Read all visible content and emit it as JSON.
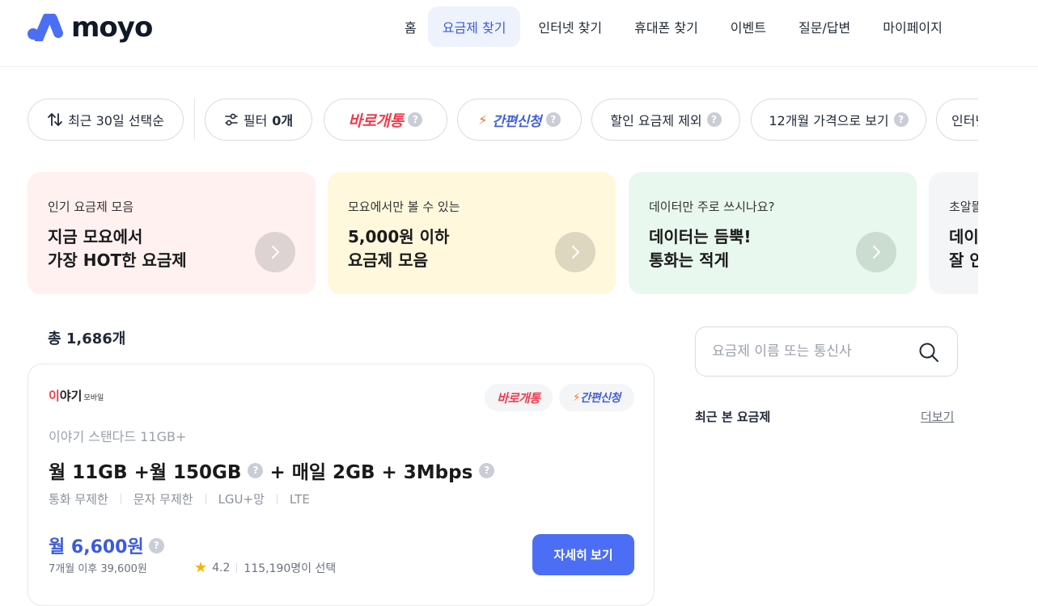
{
  "header": {
    "logo_text": "moyo",
    "nav": [
      "홈",
      "요금제 찾기",
      "인터넷 찾기",
      "휴대폰 찾기",
      "이벤트",
      "질문/답변",
      "마이페이지"
    ],
    "active_nav": "요금제 찾기"
  },
  "filters": {
    "sort_label": "최근 30일 선택순",
    "filter_label": "필터",
    "filter_count": "0개",
    "baro": "바로개통",
    "gan": "간편신청",
    "discount_exclude": "할인 요금제 제외",
    "twelve_month": "12개월 가격으로 보기",
    "internet_partial": "인터넷"
  },
  "banners": [
    {
      "sub": "인기 요금제 모음",
      "title": "지금 모요에서\n가장 HOT한 요금제",
      "bg": "#fff1f0",
      "arrow_bg": "#ddd3d2"
    },
    {
      "sub": "모요에서만 볼 수 있는",
      "title": "5,000원 이하\n요금제 모음",
      "bg": "#fff8dc",
      "arrow_bg": "#ddd7c0"
    },
    {
      "sub": "데이터만 주로 쓰시나요?",
      "title": "데이터는 듬뿍!\n통화는 적게",
      "bg": "#e9f8ee",
      "arrow_bg": "#cbdcd0"
    },
    {
      "sub": "초알뜰",
      "title": "데이\n잘 안",
      "bg": "#f4f5f7",
      "arrow_bg": "#d9dbe0"
    }
  ],
  "total": "총 1,686개",
  "plan": {
    "brand": "이야기",
    "brand_sub": "모바일",
    "tag_baro": "바로개통",
    "tag_gan": "간편신청",
    "name": "이야기 스탠다드 11GB+",
    "main_part1": "월 11GB +월 150GB",
    "main_part2": "+ 매일 2GB + 3Mbps",
    "specs": [
      "통화 무제한",
      "문자 무제한",
      "LGU+망",
      "LTE"
    ],
    "price": "월 6,600원",
    "after_price": "7개월 이후 39,600원",
    "rating": "4.2",
    "selected_count": "115,190명이 선택",
    "detail_button": "자세히 보기"
  },
  "search": {
    "placeholder": "요금제 이름 또는 통신사"
  },
  "recent": {
    "title": "최근 본 요금제",
    "more": "더보기"
  },
  "colors": {
    "accent": "#3b5bdb",
    "button": "#4c6ef5",
    "baro": "#ef3b4c",
    "gan": "#4260d8"
  }
}
